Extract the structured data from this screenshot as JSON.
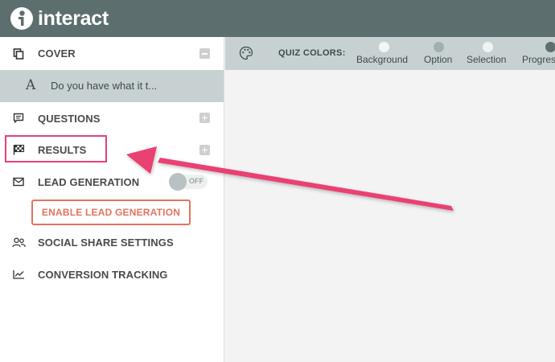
{
  "app": {
    "logo_text": "interact"
  },
  "sidebar": {
    "cover": {
      "label": "COVER",
      "sub_text": "Do you have what it t...",
      "sub_letter": "A"
    },
    "questions": {
      "label": "QUESTIONS"
    },
    "results": {
      "label": "RESULTS"
    },
    "lead_generation": {
      "label": "LEAD GENERATION",
      "toggle_label": "OFF",
      "button_label": "ENABLE LEAD GENERATION"
    },
    "social_share": {
      "label": "SOCIAL SHARE SETTINGS"
    },
    "conversion_tracking": {
      "label": "CONVERSION TRACKING"
    }
  },
  "toolbar": {
    "label": "QUIZ COLORS:",
    "swatches": [
      {
        "label": "Background",
        "color": "#f4f6f6"
      },
      {
        "label": "Option",
        "color": "#a3aeaf"
      },
      {
        "label": "Selection",
        "color": "#eef3f4"
      },
      {
        "label": "Progress",
        "color": "#5f6e6f"
      }
    ]
  },
  "colors": {
    "topbar": "#5d6e6e",
    "highlight": "#e8407a",
    "accent_button": "#e3735e"
  }
}
